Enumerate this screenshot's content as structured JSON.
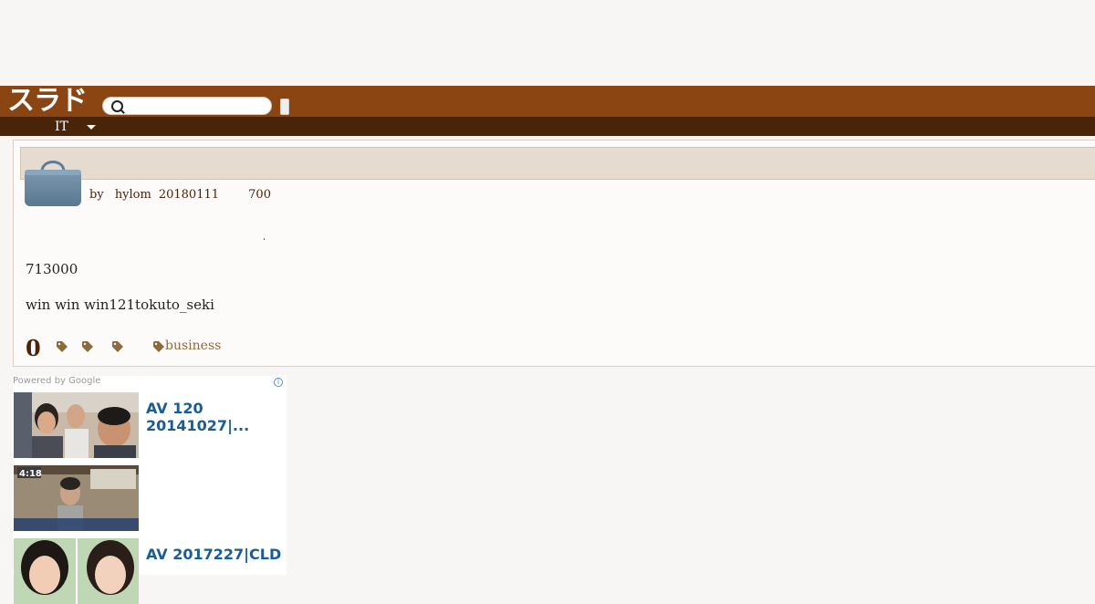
{
  "header": {
    "logo_text": "スラド",
    "search_placeholder": "",
    "search_value": ""
  },
  "nav": {
    "section_label": "IT"
  },
  "article": {
    "title": "",
    "meta_by": "by",
    "author": "hylom",
    "date": "20180111",
    "read_count": "700",
    "paragraph_1": "713000",
    "paragraph_2": "win win win121tokuto_seki",
    "comment_count": "0",
    "tag_label": "business"
  },
  "ads": {
    "powered_by": "Powered by Google",
    "items": [
      {
        "title": "AV 120 20141027|..."
      },
      {
        "title": ""
      },
      {
        "title": " AV 2017227|CLD"
      }
    ],
    "thumb_2_time": "4:18"
  },
  "colors": {
    "header_bg": "#8b4513",
    "nav_bg": "#4a2409",
    "title_bar_bg": "#e5dbce",
    "link_blue": "#1a5c96",
    "tag_brown": "#8b6a3e"
  },
  "icons": [
    "search-icon",
    "chevron-down-icon",
    "shopping-bag-icon",
    "tag-icon",
    "adchoices-icon"
  ]
}
